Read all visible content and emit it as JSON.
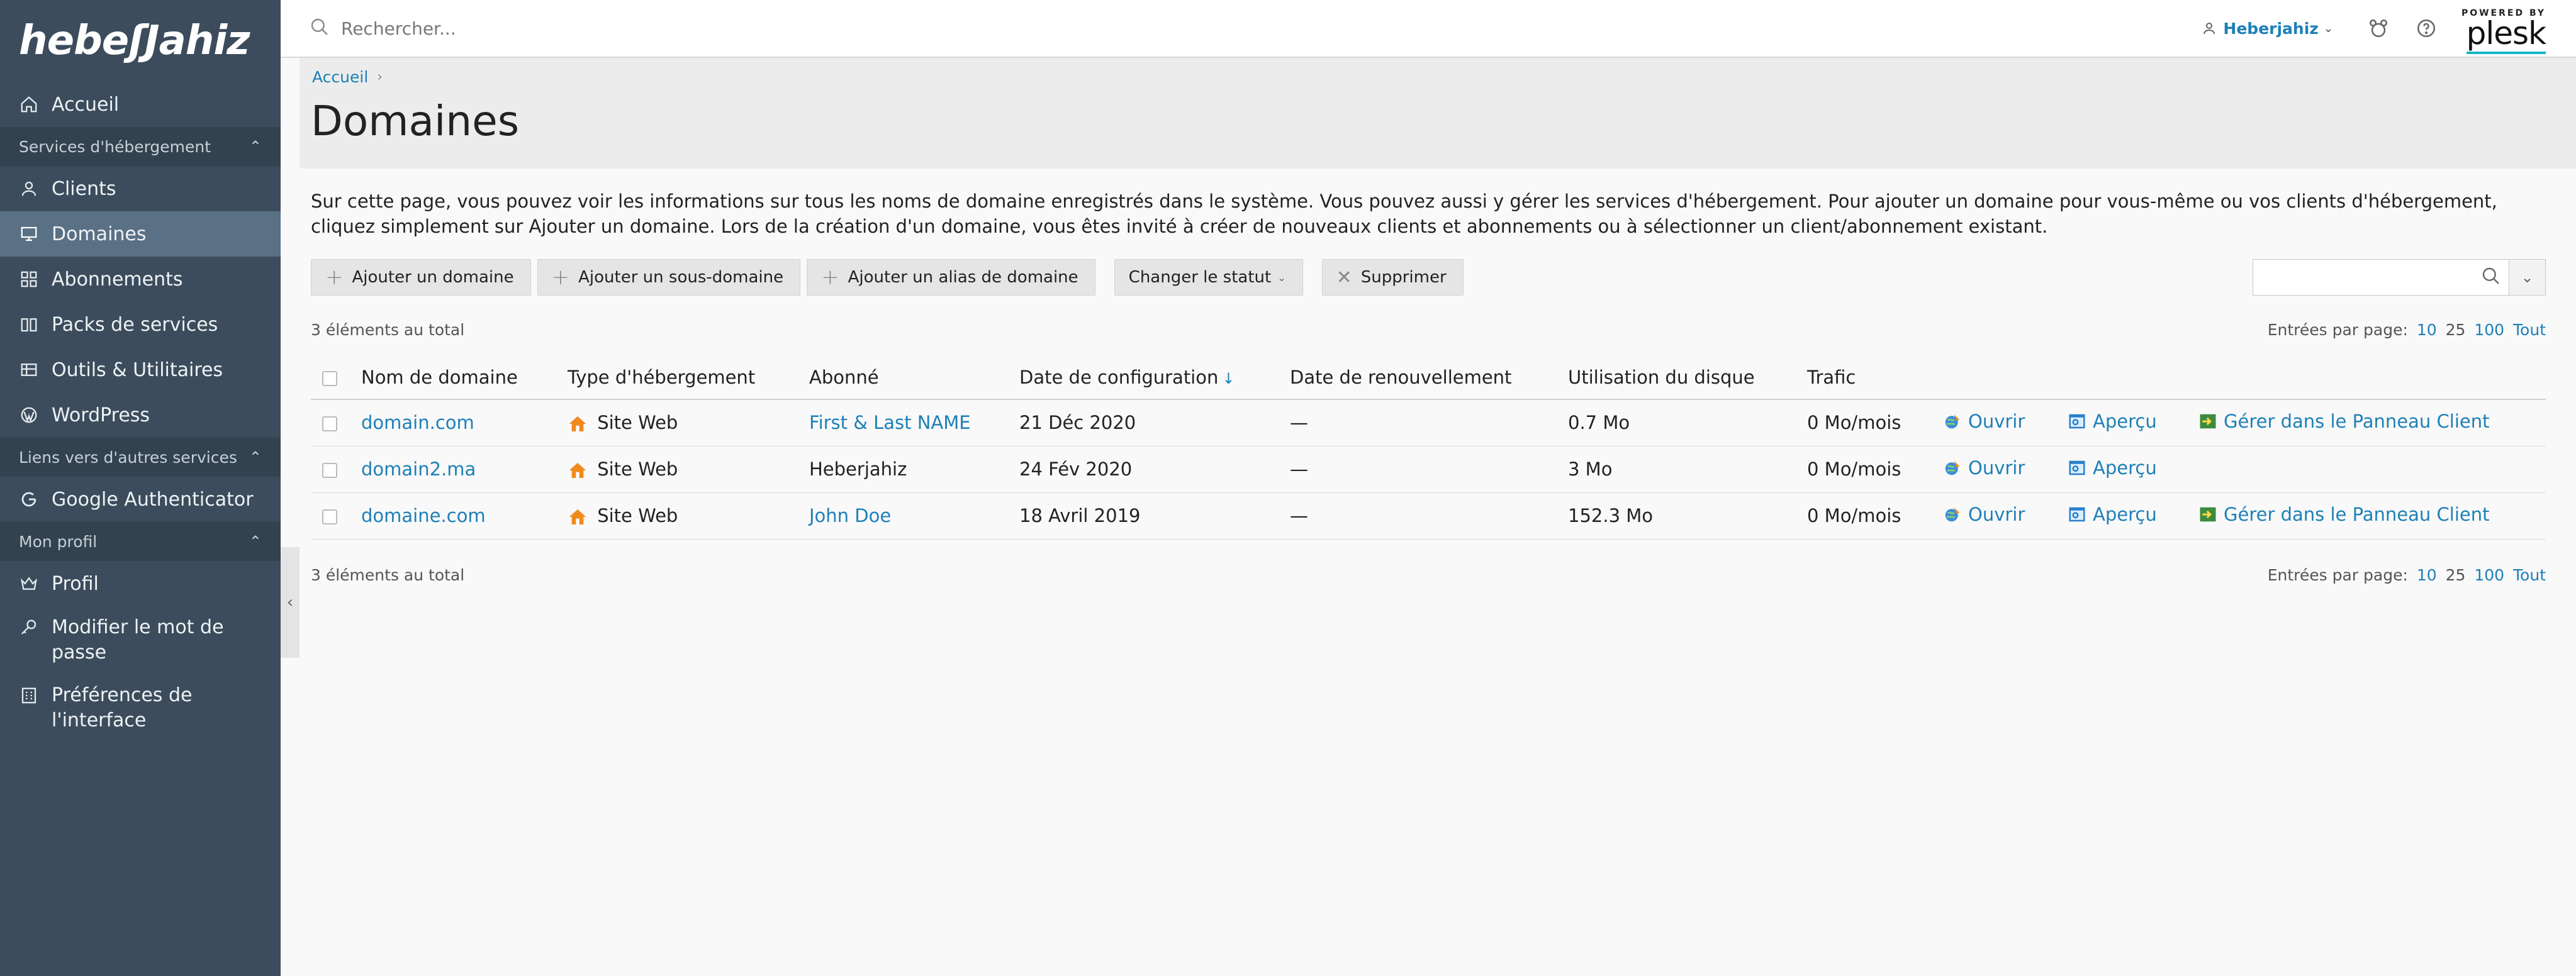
{
  "brand": {
    "logo_text": "hebeʃJahiz"
  },
  "sidebar": {
    "items": [
      {
        "label": "Accueil",
        "icon": "home-icon"
      }
    ],
    "sections": [
      {
        "title": "Services d'hébergement",
        "items": [
          {
            "label": "Clients",
            "icon": "user-icon"
          },
          {
            "label": "Domaines",
            "icon": "monitor-icon",
            "active": true
          },
          {
            "label": "Abonnements",
            "icon": "grid-icon"
          },
          {
            "label": "Packs de services",
            "icon": "book-icon"
          },
          {
            "label": "Outils & Utilitaires",
            "icon": "tools-icon"
          },
          {
            "label": "WordPress",
            "icon": "wordpress-icon"
          }
        ]
      },
      {
        "title": "Liens vers d'autres services",
        "items": [
          {
            "label": "Google Authenticator",
            "icon": "google-icon"
          }
        ]
      },
      {
        "title": "Mon profil",
        "items": [
          {
            "label": "Profil",
            "icon": "crown-icon"
          },
          {
            "label": "Modifier le mot de passe",
            "icon": "key-icon"
          },
          {
            "label": "Préférences de l'interface",
            "icon": "preferences-icon"
          }
        ]
      }
    ]
  },
  "header": {
    "search_placeholder": "Rechercher...",
    "user": "Heberjahiz",
    "powered_by": "POWERED BY",
    "plesk": "plesk"
  },
  "breadcrumb": [
    "Accueil"
  ],
  "page": {
    "title": "Domaines",
    "description": "Sur cette page, vous pouvez voir les informations sur tous les noms de domaine enregistrés dans le système. Vous pouvez aussi y gérer les services d'hébergement. Pour ajouter un domaine pour vous-même ou vos clients d'hébergement, cliquez simplement sur Ajouter un domaine. Lors de la création d'un domaine, vous êtes invité à créer de nouveaux clients et abonnements ou à sélectionner un client/abonnement existant."
  },
  "toolbar": {
    "add_domain": "Ajouter un domaine",
    "add_subdomain": "Ajouter un sous-domaine",
    "add_alias": "Ajouter un alias de domaine",
    "change_status": "Changer le statut",
    "delete": "Supprimer"
  },
  "list": {
    "total": "3 éléments au total",
    "per_page_label": "Entrées par page:",
    "per_page_options": [
      "10",
      "25",
      "100",
      "Tout"
    ],
    "columns": [
      "Nom de domaine",
      "Type d'hébergement",
      "Abonné",
      "Date de configuration",
      "Date de renouvellement",
      "Utilisation du disque",
      "Trafic"
    ],
    "actions": {
      "open": "Ouvrir",
      "preview": "Aperçu",
      "manage": "Gérer dans le Panneau Client"
    },
    "rows": [
      {
        "domain": "domain.com",
        "hosting": "Site Web",
        "subscriber": "First & Last NAME",
        "subscriber_link": true,
        "config_date": "21 Déc 2020",
        "renewal": "—",
        "disk": "0.7 Mo",
        "traffic": "0 Mo/mois",
        "manage": true
      },
      {
        "domain": "domain2.ma",
        "hosting": "Site Web",
        "subscriber": "Heberjahiz",
        "subscriber_link": false,
        "config_date": "24 Fév 2020",
        "renewal": "—",
        "disk": "3 Mo",
        "traffic": "0 Mo/mois",
        "manage": false
      },
      {
        "domain": "domaine.com",
        "hosting": "Site Web",
        "subscriber": "John Doe",
        "subscriber_link": true,
        "config_date": "18 Avril 2019",
        "renewal": "—",
        "disk": "152.3 Mo",
        "traffic": "0 Mo/mois",
        "manage": true
      }
    ]
  }
}
